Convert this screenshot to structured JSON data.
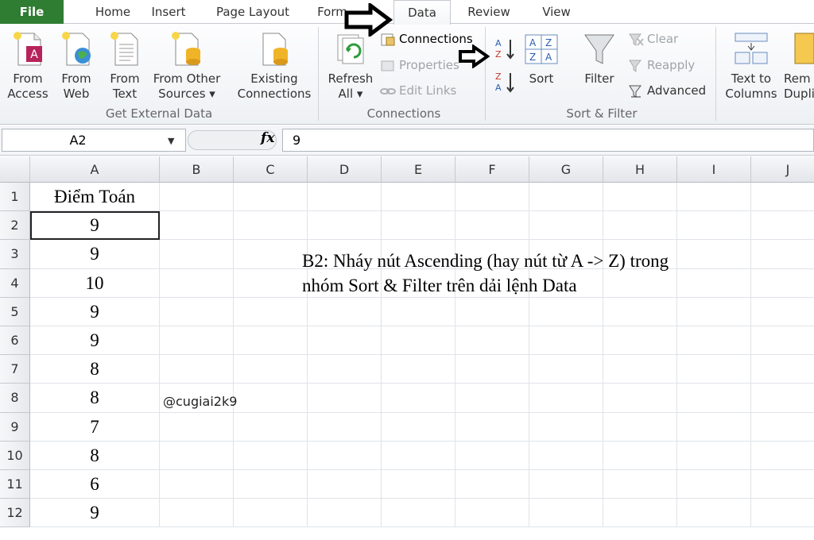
{
  "tabs": [
    "File",
    "Home",
    "Insert",
    "Page Layout",
    "Form",
    "Data",
    "Review",
    "View"
  ],
  "ribbon": {
    "get_external": {
      "from_access": [
        "From",
        "Access"
      ],
      "from_web": [
        "From",
        "Web"
      ],
      "from_text": [
        "From",
        "Text"
      ],
      "from_other": [
        "From Other",
        "Sources ▾"
      ],
      "existing": [
        "Existing",
        "Connections"
      ],
      "label": "Get External Data"
    },
    "connections": {
      "refresh": [
        "Refresh",
        "All ▾"
      ],
      "connections": "Connections",
      "properties": "Properties",
      "edit_links": "Edit Links",
      "label": "Connections"
    },
    "sort_filter": {
      "sort": "Sort",
      "filter": "Filter",
      "clear": "Clear",
      "reapply": "Reapply",
      "advanced": "Advanced",
      "label": "Sort & Filter"
    },
    "data_tools": {
      "text_to_columns": [
        "Text to",
        "Columns"
      ],
      "remove_dup": [
        "Rem",
        "Dupli"
      ]
    }
  },
  "formula_bar": {
    "name_box": "A2",
    "fx": "fx",
    "value": "9"
  },
  "columns": [
    "A",
    "B",
    "C",
    "D",
    "E",
    "F",
    "G",
    "H",
    "I",
    "J"
  ],
  "rows": [
    "1",
    "2",
    "3",
    "4",
    "5",
    "6",
    "7",
    "8",
    "9",
    "10",
    "11",
    "12"
  ],
  "colA": [
    "Điểm Toán",
    "9",
    "9",
    "10",
    "9",
    "9",
    "8",
    "8",
    "7",
    "8",
    "6",
    "9"
  ],
  "watermark": "@cugiai2k9",
  "note": [
    "B2: Nháy nút Ascending (hay nút từ A -> Z) trong",
    "nhóm Sort & Filter trên dải lệnh Data"
  ]
}
